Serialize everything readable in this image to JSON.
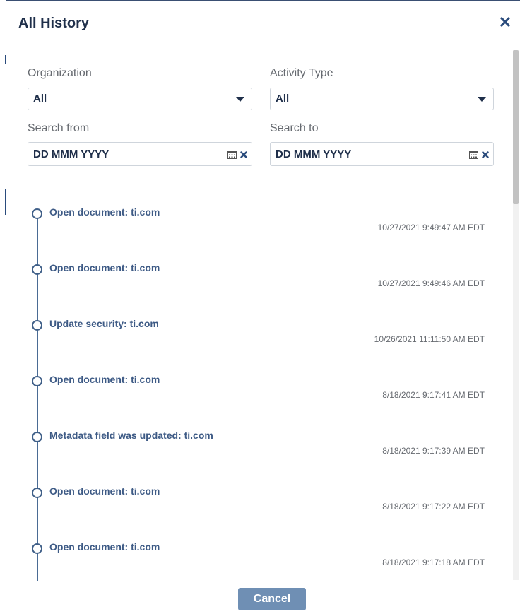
{
  "dialog": {
    "title": "All History"
  },
  "filters": {
    "organization": {
      "label": "Organization",
      "value": "All"
    },
    "activity_type": {
      "label": "Activity Type",
      "value": "All"
    },
    "search_from": {
      "label": "Search from",
      "value": "DD MMM YYYY"
    },
    "search_to": {
      "label": "Search to",
      "value": "DD MMM YYYY"
    }
  },
  "history": [
    {
      "action": "Open document: ti.com",
      "time": "10/27/2021 9:49:47 AM EDT"
    },
    {
      "action": "Open document: ti.com",
      "time": "10/27/2021 9:49:46 AM EDT"
    },
    {
      "action": "Update security: ti.com",
      "time": "10/26/2021 11:11:50 AM EDT"
    },
    {
      "action": "Open document: ti.com",
      "time": "8/18/2021 9:17:41 AM EDT"
    },
    {
      "action": "Metadata field was updated: ti.com",
      "time": "8/18/2021 9:17:39 AM EDT"
    },
    {
      "action": "Open document: ti.com",
      "time": "8/18/2021 9:17:22 AM EDT"
    },
    {
      "action": "Open document: ti.com",
      "time": "8/18/2021 9:17:18 AM EDT"
    }
  ],
  "footer": {
    "cancel_label": "Cancel"
  },
  "colors": {
    "accent": "#3d5a85",
    "button": "#6f8fb4",
    "title": "#1f2f4a"
  },
  "icons": {
    "close": "close-icon",
    "calendar": "calendar-icon",
    "clear": "clear-icon",
    "dropdown": "chevron-down-icon"
  }
}
